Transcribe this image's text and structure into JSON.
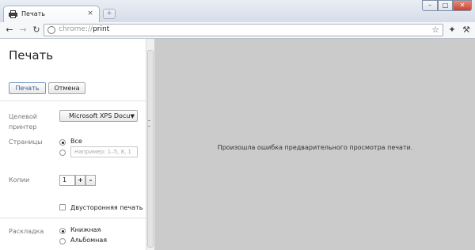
{
  "window": {
    "tab_title": "Печать",
    "tab_close": "×",
    "new_tab": "+",
    "controls": {
      "minimize": "–",
      "maximize": "□",
      "close": "✕"
    }
  },
  "toolbar": {
    "url_scheme": "chrome://",
    "url_path": "print",
    "icons": [
      "back-icon",
      "forward-icon",
      "reload-icon",
      "page-icon",
      "star-icon",
      "extension-icon",
      "wrench-icon"
    ]
  },
  "sidebar": {
    "heading": "Печать",
    "print_button": "Печать",
    "cancel_button": "Отмена",
    "printer": {
      "label_line1": "Целевой",
      "label_line2": "принтер",
      "value": "Microsoft XPS Docu"
    },
    "pages": {
      "label": "Страницы",
      "option_all": "Все",
      "range_placeholder": "Например: 1–5, 8, 1"
    },
    "copies": {
      "label": "Копии",
      "value": "1",
      "increment": "+",
      "decrement": "–"
    },
    "duplex": {
      "label": "Двусторонняя печать"
    },
    "layout": {
      "label": "Раскладка",
      "portrait": "Книжная",
      "landscape": "Альбомная"
    }
  },
  "preview": {
    "message": "Произошла ошибка предварительного просмотра печати."
  }
}
